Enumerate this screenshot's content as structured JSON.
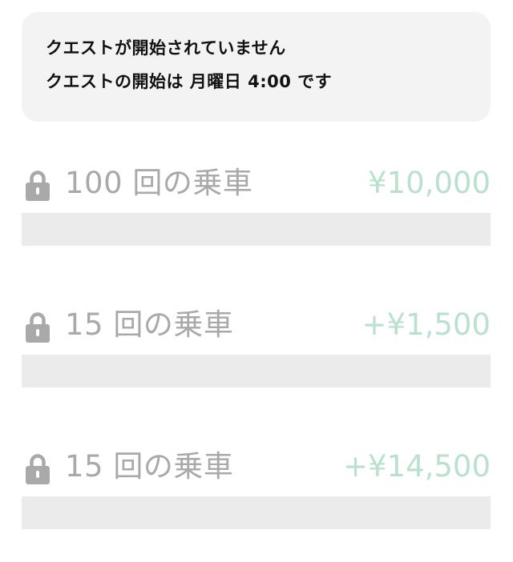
{
  "notice": {
    "line1": "クエストが開始されていません",
    "line2": "クエストの開始は 月曜日 4:00 です"
  },
  "quests": [
    {
      "label": "100 回の乗車",
      "reward": "¥10,000",
      "progress": 0,
      "locked": true
    },
    {
      "label": "15 回の乗車",
      "reward": "+¥1,500",
      "progress": 0,
      "locked": true
    },
    {
      "label": "15 回の乗車",
      "reward": "+¥14,500",
      "progress": 0,
      "locked": true
    }
  ],
  "colors": {
    "reward_accent": "#b9e1cd",
    "locked_gray": "#a9a9a9",
    "track": "#ebebeb",
    "notice_bg": "#f3f3f3"
  },
  "icons": {
    "quest_status": "lock-icon"
  }
}
